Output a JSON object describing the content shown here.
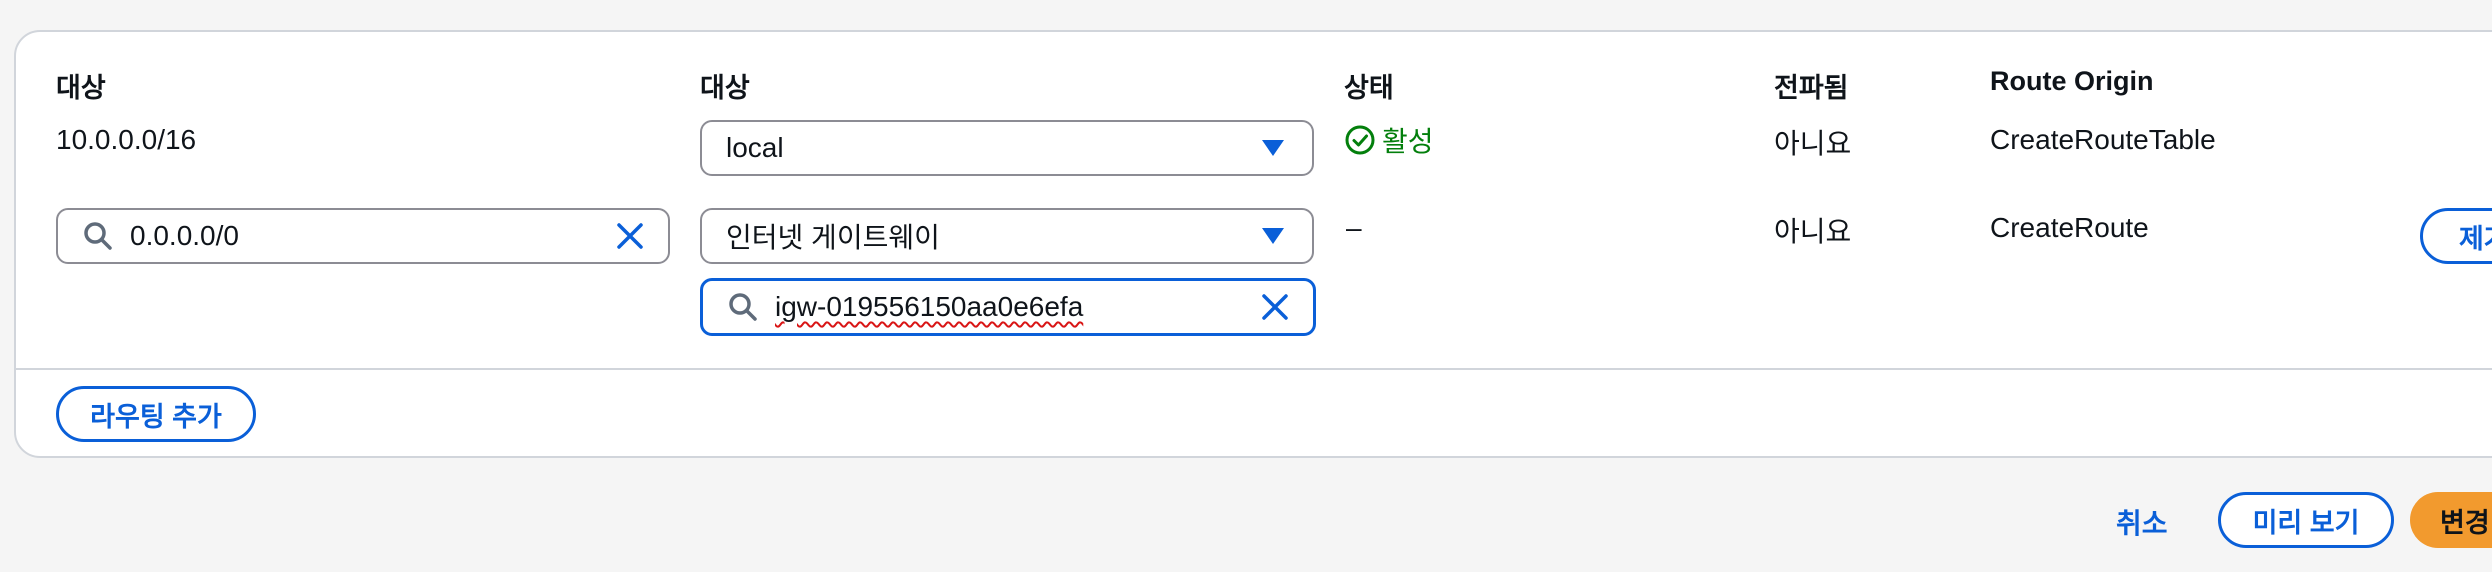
{
  "columns": {
    "destination": "대상",
    "target": "대상",
    "status": "상태",
    "propagated": "전파됨",
    "route_origin": "Route Origin"
  },
  "routes": [
    {
      "destination": "10.0.0.0/16",
      "target_select": "local",
      "status": "활성",
      "propagated": "아니요",
      "route_origin": "CreateRouteTable"
    },
    {
      "destination_input": "0.0.0.0/0",
      "target_select": "인터넷 게이트웨이",
      "target_id_input": "igw-019556150aa0e6efa",
      "status": "–",
      "propagated": "아니요",
      "route_origin": "CreateRoute",
      "remove_label": "제거"
    }
  ],
  "add_route_label": "라우팅 추가",
  "footer": {
    "cancel_label": "취소",
    "preview_label": "미리 보기",
    "save_label": "변경 사항 저장"
  },
  "colors": {
    "link_blue": "#0a5fd8",
    "success_green": "#037f0c",
    "primary_orange": "#f29a2e"
  }
}
